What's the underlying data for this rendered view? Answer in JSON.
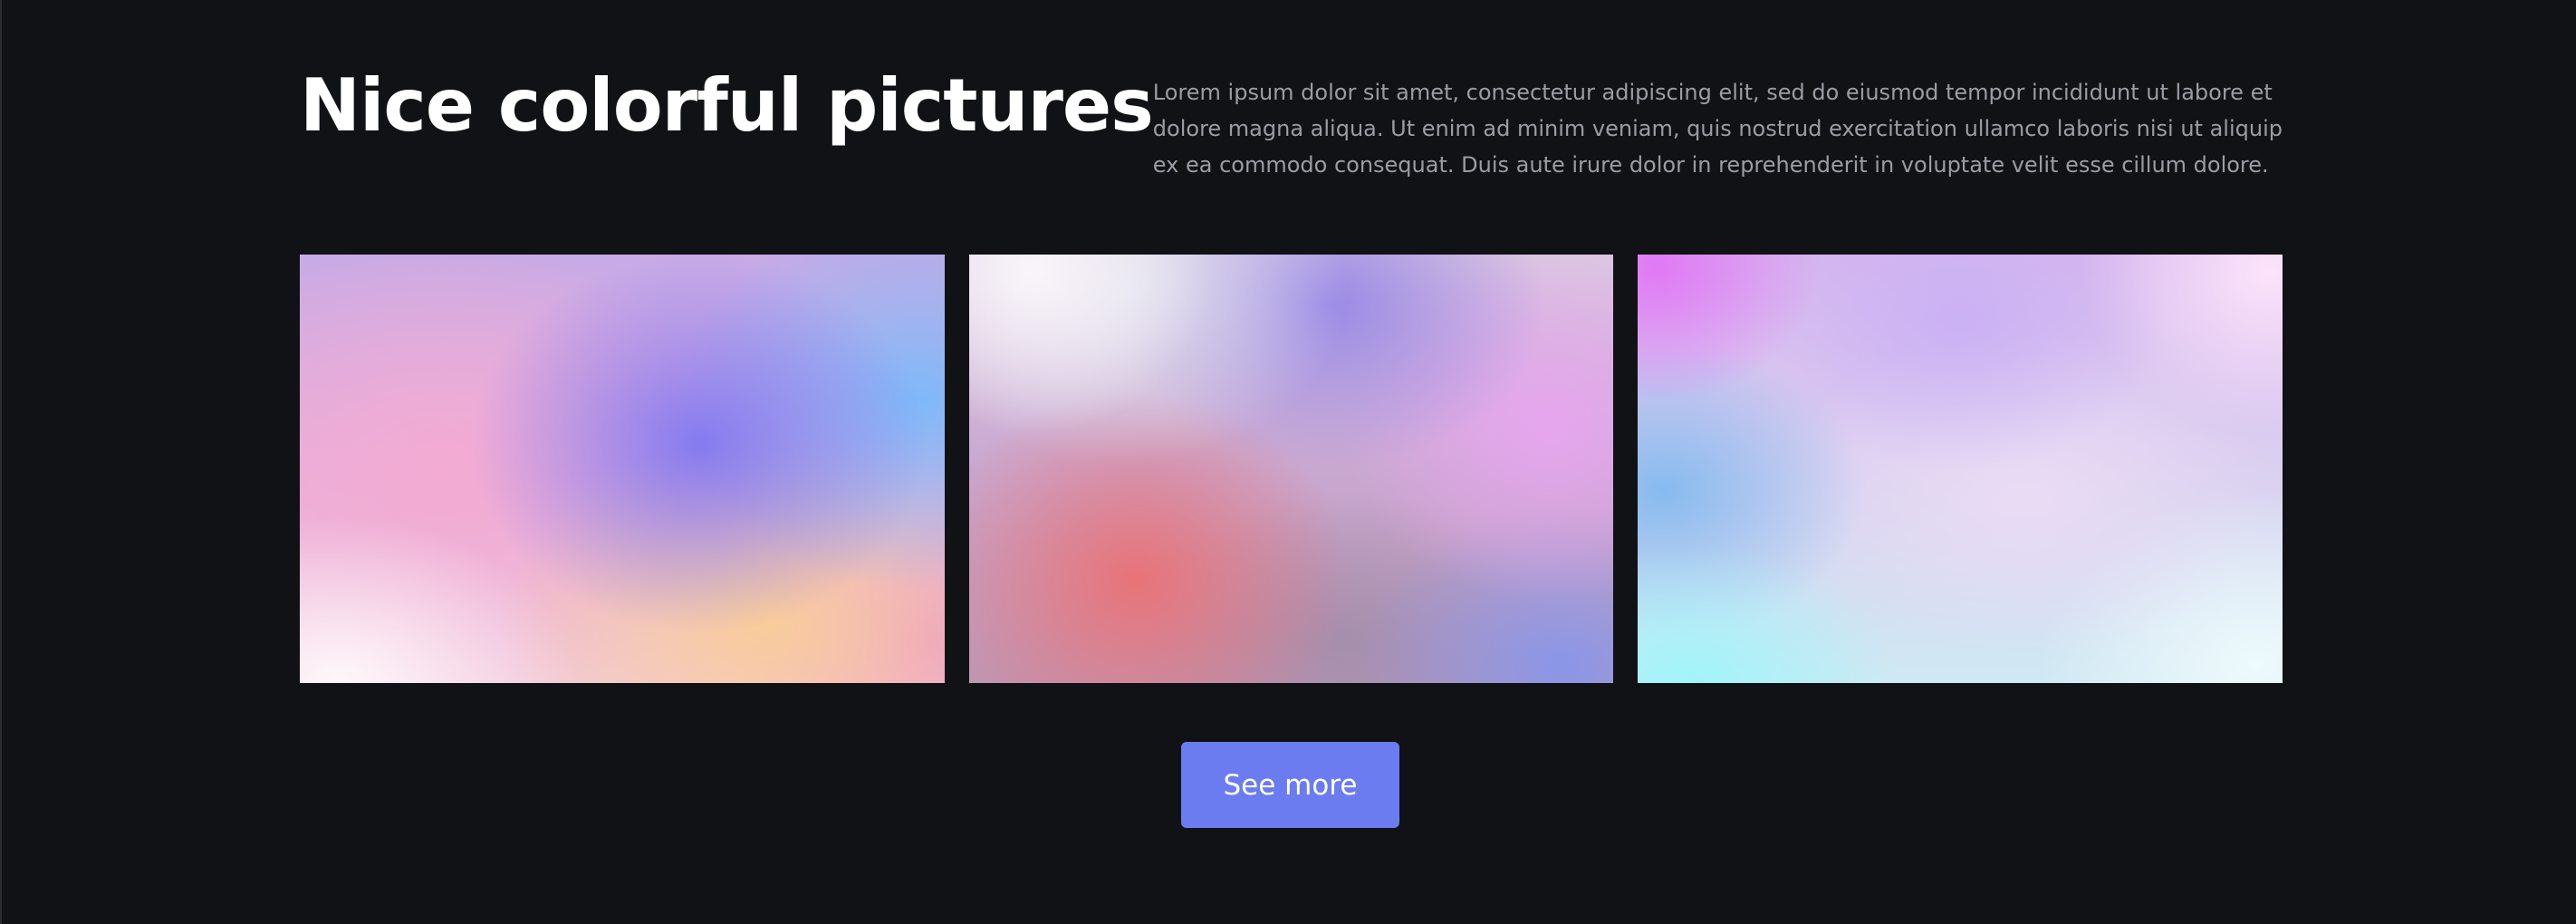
{
  "header": {
    "title": "Nice colorful pictures",
    "description": "Lorem ipsum dolor sit amet, consectetur adipiscing elit, sed do eiusmod tempor incididunt ut labore et dolore magna aliqua. Ut enim ad minim veniam, quis nostrud exercitation ullamco laboris nisi ut aliquip ex ea commodo consequat. Duis aute irure dolor in reprehenderit in voluptate velit esse cillum dolore."
  },
  "gallery": {
    "images": [
      {
        "dominant_colors": [
          "#c7aae6",
          "#8c86f0",
          "#f3b6d6",
          "#f8d79a",
          "#83c0f5"
        ]
      },
      {
        "dominant_colors": [
          "#f3eef5",
          "#9b8ae6",
          "#e07a80",
          "#e9a8ee",
          "#8d98eb"
        ]
      },
      {
        "dominant_colors": [
          "#e17bf2",
          "#dcc9f2",
          "#8fc0ee",
          "#aef5f8",
          "#fbe6f9"
        ]
      }
    ]
  },
  "actions": {
    "see_more_label": "See more"
  },
  "theme": {
    "background": "#111215",
    "button_color": "#6a7cef",
    "title_color": "#ffffff",
    "text_color": "#9a9da5"
  }
}
